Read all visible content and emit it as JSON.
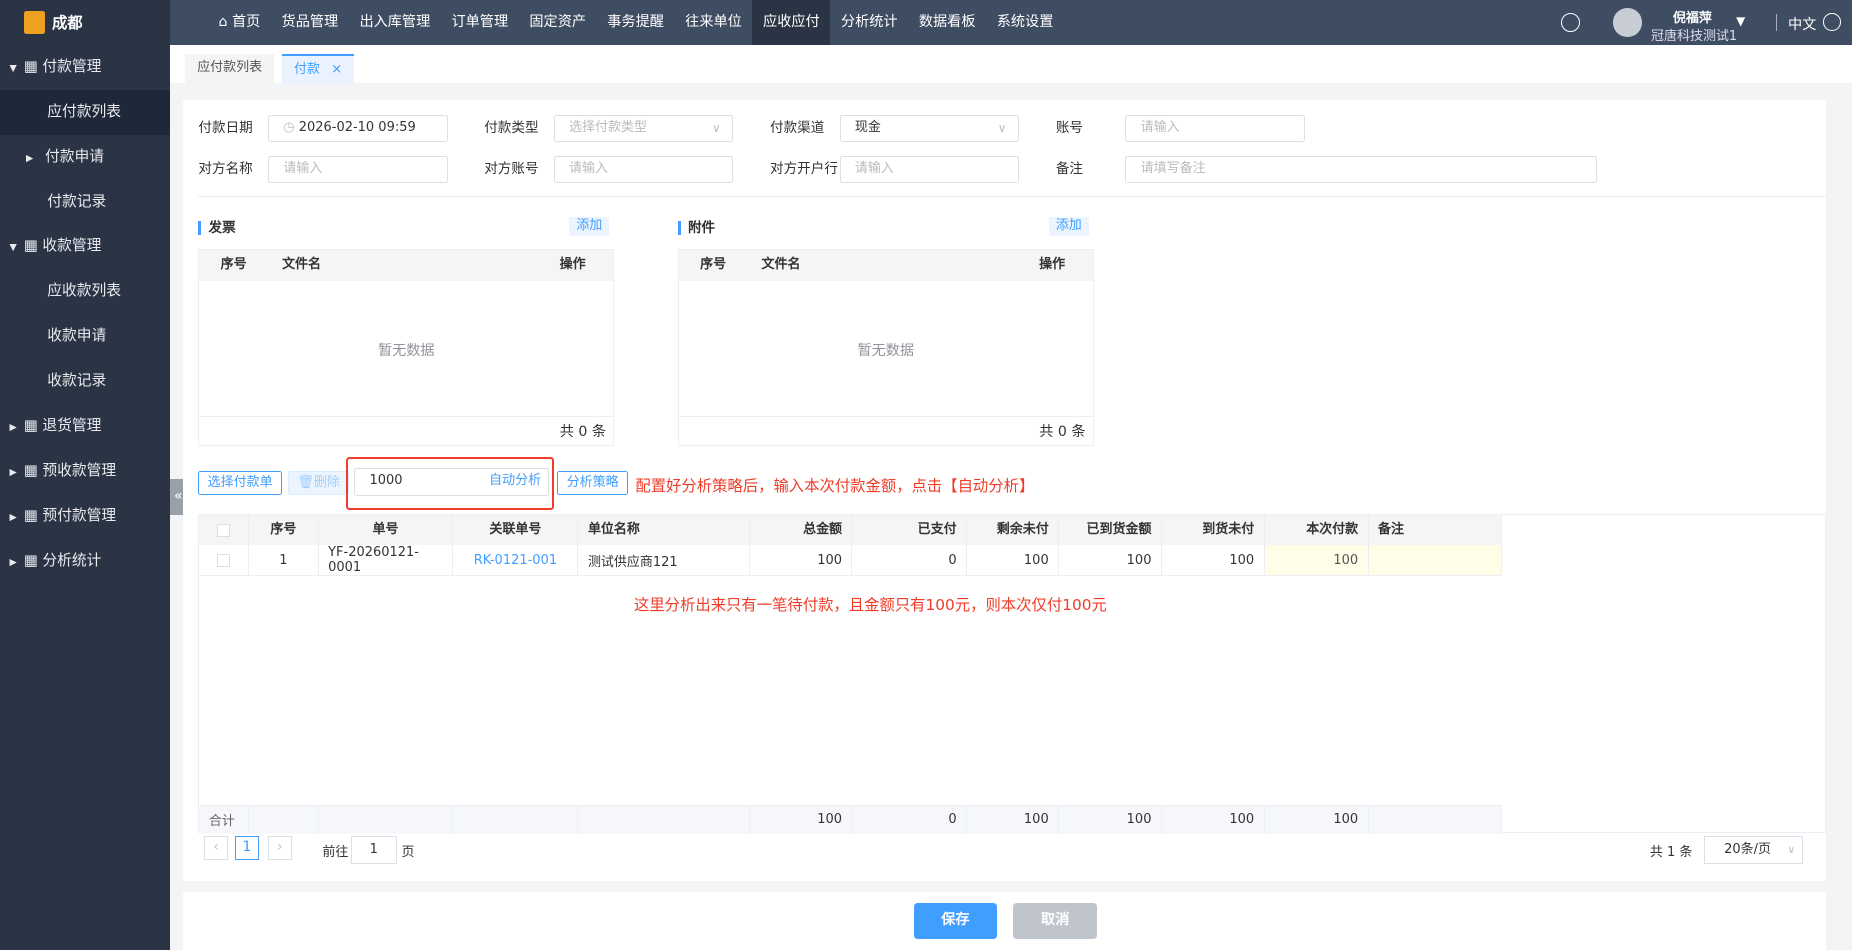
{
  "app": {
    "brand": "成都"
  },
  "topnav": {
    "items": [
      "首页",
      "货品管理",
      "出入库管理",
      "订单管理",
      "固定资产",
      "事务提醒",
      "往来单位",
      "应收应付",
      "分析统计",
      "数据看板",
      "系统设置"
    ],
    "active": "应收应付",
    "user_name": "倪福萍",
    "company": "冠唐科技测试1",
    "language": "中文"
  },
  "sidebar": {
    "items": [
      {
        "label": "付款管理",
        "type": "group"
      },
      {
        "label": "应付款列表",
        "type": "sub",
        "active": true
      },
      {
        "label": "付款申请",
        "type": "group-sub"
      },
      {
        "label": "付款记录",
        "type": "sub"
      },
      {
        "label": "收款管理",
        "type": "group"
      },
      {
        "label": "应收款列表",
        "type": "sub"
      },
      {
        "label": "收款申请",
        "type": "sub"
      },
      {
        "label": "收款记录",
        "type": "sub"
      },
      {
        "label": "退货管理",
        "type": "group"
      },
      {
        "label": "预收款管理",
        "type": "group"
      },
      {
        "label": "预付款管理",
        "type": "group"
      },
      {
        "label": "分析统计",
        "type": "group"
      }
    ]
  },
  "tabs": [
    {
      "label": "应付款列表"
    },
    {
      "label": "付款",
      "close": "×"
    }
  ],
  "form": {
    "pay_date_label": "付款日期",
    "pay_date": "2026-02-10 09:59",
    "pay_type_label": "付款类型",
    "pay_type_placeholder": "选择付款类型",
    "channel_label": "付款渠道",
    "channel": "现金",
    "account_label": "账号",
    "account_placeholder": "请输入",
    "party_name_label": "对方名称",
    "party_name_placeholder": "请输入",
    "party_account_label": "对方账号",
    "party_account_placeholder": "请输入",
    "party_bank_label": "对方开户行",
    "party_bank_placeholder": "请输入",
    "remark_label": "备注",
    "remark_placeholder": "请填写备注"
  },
  "invoice": {
    "title": "发票",
    "add": "添加",
    "cols": [
      "序号",
      "文件名",
      "操作"
    ],
    "empty": "暂无数据",
    "total": "共 0 条"
  },
  "attachment": {
    "title": "附件",
    "add": "添加",
    "cols": [
      "序号",
      "文件名",
      "操作"
    ],
    "empty": "暂无数据",
    "total": "共 0 条"
  },
  "toolbar": {
    "select_btn": "选择付款单",
    "delete_btn": "删除",
    "amount": "1000",
    "auto_analyze": "自动分析",
    "strategy_btn": "分析策略",
    "note": "配置好分析策略后，输入本次付款金额，点击【自动分析】"
  },
  "table": {
    "cols": [
      "序号",
      "单号",
      "关联单号",
      "单位名称",
      "总金额",
      "已支付",
      "剩余未付",
      "已到货金额",
      "到货未付",
      "本次付款",
      "备注"
    ],
    "rows": [
      {
        "idx": "1",
        "no": "YF-20260121-0001",
        "ref": "RK-0121-001",
        "unit": "测试供应商121",
        "total": "100",
        "paid": "0",
        "remain": "100",
        "arrived": "100",
        "arrived_unpaid": "100",
        "this_pay": "100",
        "remark": ""
      }
    ],
    "note": "这里分析出来只有一笔待付款，且金额只有100元，则本次仅付100元",
    "sum": {
      "label": "合计",
      "total": "100",
      "paid": "0",
      "remain": "100",
      "arrived": "100",
      "arrived_unpaid": "100",
      "this_pay": "100"
    }
  },
  "pager": {
    "page": "1",
    "goto_label": "前往",
    "goto_value": "1",
    "page_unit": "页",
    "total": "共 1 条",
    "size": "20条/页"
  },
  "footer": {
    "save": "保存",
    "cancel": "取消"
  }
}
